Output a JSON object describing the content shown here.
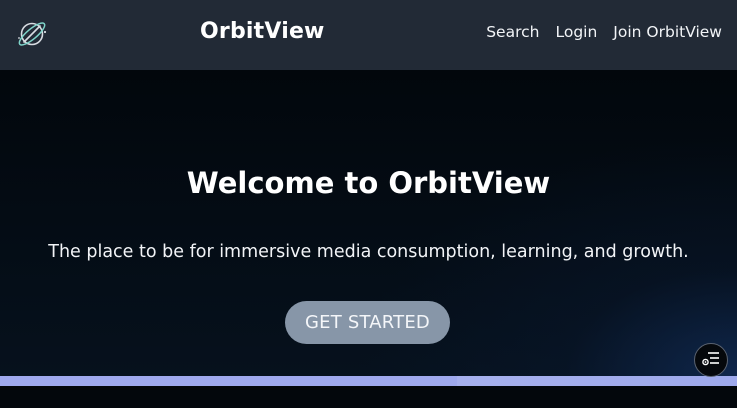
{
  "header": {
    "brand": "OrbitView",
    "logo_icon": "orbit-planet-icon",
    "nav": {
      "search": "Search",
      "login": "Login",
      "join": "Join OrbitView"
    }
  },
  "hero": {
    "title": "Welcome to OrbitView",
    "subtitle": "The place to be for immersive media consumption, learning, and growth.",
    "cta": "GET STARTED"
  },
  "progress": {
    "value_fraction": 0.62
  },
  "floating_button": {
    "icon": "settings-list-icon"
  },
  "colors": {
    "header_bg": "#222a36",
    "hero_bg": "#050b14",
    "cta_bg": "#8796a8",
    "progress": "#9fa9ee"
  }
}
